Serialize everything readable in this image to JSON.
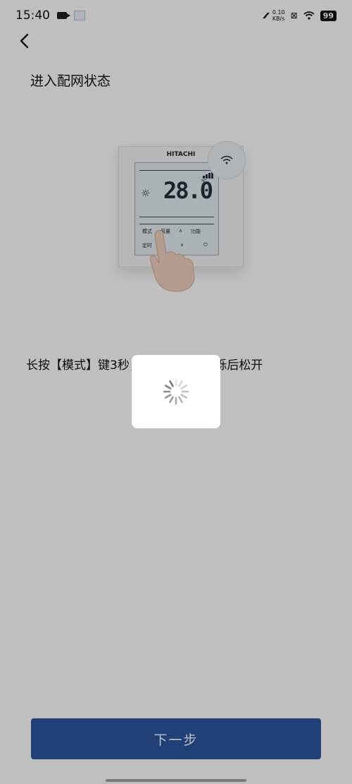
{
  "status_bar": {
    "time": "15:40",
    "network_speed_value": "0.10",
    "network_speed_unit": "KB/s",
    "battery": "99"
  },
  "page": {
    "title": "进入配网状态",
    "instruction": "长按【模式】键3秒，待WIFI图标闪烁后松开"
  },
  "device_illustration": {
    "brand": "HITACHI",
    "temperature": "28.0",
    "temp_unit": "℃",
    "keys": [
      "模式",
      "风量",
      "功能",
      "定时"
    ]
  },
  "footer": {
    "next_label": "下一步"
  },
  "colors": {
    "primary": "#2d56a0",
    "overlay": "rgba(0,0,0,0.25)"
  },
  "icons": [
    "back-arrow-icon",
    "loading-spinner-icon",
    "wifi-icon",
    "video-icon",
    "battery-icon"
  ]
}
